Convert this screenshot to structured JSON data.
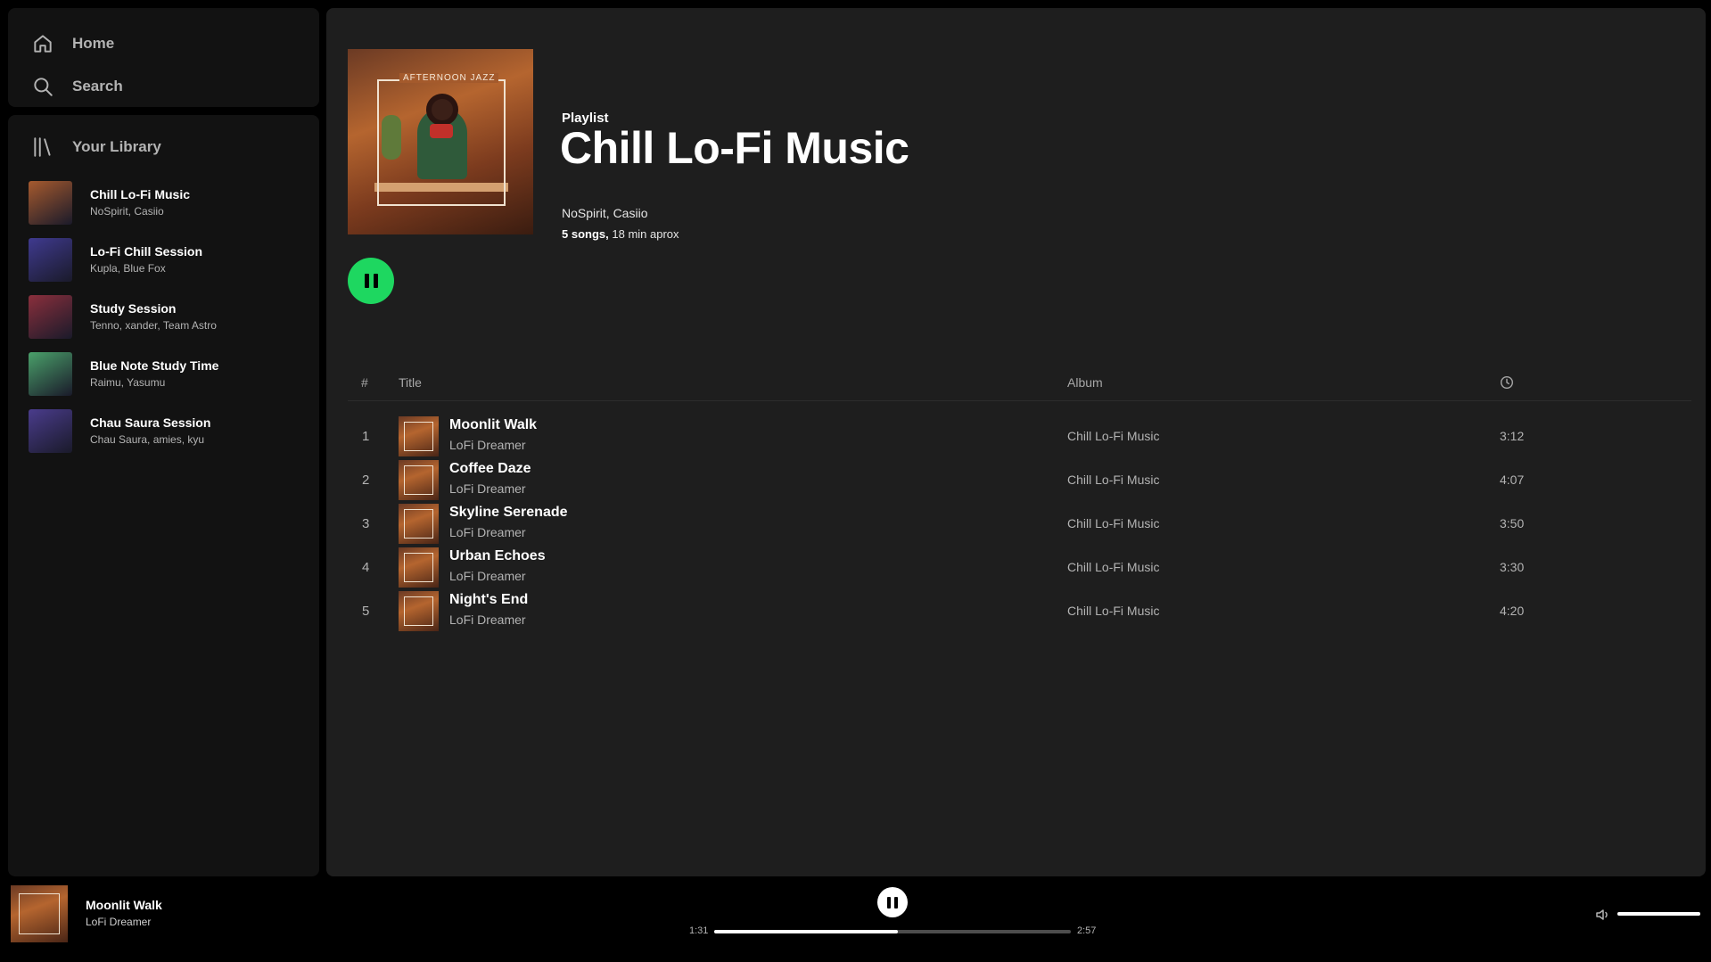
{
  "nav": {
    "home_label": "Home",
    "search_label": "Search",
    "home_icon": "home-icon",
    "search_icon": "search-icon"
  },
  "library": {
    "title": "Your Library",
    "icon": "library-icon",
    "items": [
      {
        "title": "Chill Lo-Fi Music",
        "subtitle": "NoSpirit, Casiio",
        "color": "#a65a2e"
      },
      {
        "title": "Lo-Fi Chill Session",
        "subtitle": "Kupla, Blue Fox",
        "color": "#3f3a8f"
      },
      {
        "title": "Study Session",
        "subtitle": "Tenno, xander, Team Astro",
        "color": "#8a2f3c"
      },
      {
        "title": "Blue Note Study Time",
        "subtitle": "Raimu, Yasumu",
        "color": "#4aa06a"
      },
      {
        "title": "Chau Saura Session",
        "subtitle": "Chau Saura, amies, kyu",
        "color": "#4a3c8c"
      }
    ]
  },
  "playlist": {
    "type_label": "Playlist",
    "title": "Chill Lo-Fi Music",
    "owners": "NoSpirit, Casiio",
    "song_count": "5 songs,",
    "duration": "18 min aprox",
    "cover_text": "AFTERNOON JAZZ"
  },
  "table": {
    "col_num": "#",
    "col_title": "Title",
    "col_album": "Album",
    "duration_icon": "clock-icon",
    "tracks": [
      {
        "num": "1",
        "title": "Moonlit Walk",
        "artist": "LoFi Dreamer",
        "album": "Chill Lo-Fi Music",
        "duration": "3:12"
      },
      {
        "num": "2",
        "title": "Coffee Daze",
        "artist": "LoFi Dreamer",
        "album": "Chill Lo-Fi Music",
        "duration": "4:07"
      },
      {
        "num": "3",
        "title": "Skyline Serenade",
        "artist": "LoFi Dreamer",
        "album": "Chill Lo-Fi Music",
        "duration": "3:50"
      },
      {
        "num": "4",
        "title": "Urban Echoes",
        "artist": "LoFi Dreamer",
        "album": "Chill Lo-Fi Music",
        "duration": "3:30"
      },
      {
        "num": "5",
        "title": "Night's End",
        "artist": "LoFi Dreamer",
        "album": "Chill Lo-Fi Music",
        "duration": "4:20"
      }
    ]
  },
  "player": {
    "now_playing_title": "Moonlit Walk",
    "now_playing_artist": "LoFi Dreamer",
    "current_time": "1:31",
    "total_time": "2:57",
    "progress_fraction": 0.515,
    "volume_fraction": 1.0,
    "play_state_icon": "pause-icon",
    "volume_icon": "speaker-icon"
  },
  "colors": {
    "accent": "#1ed760",
    "background": "#000000",
    "panel": "#121212",
    "main_panel": "#1e1e1e"
  }
}
